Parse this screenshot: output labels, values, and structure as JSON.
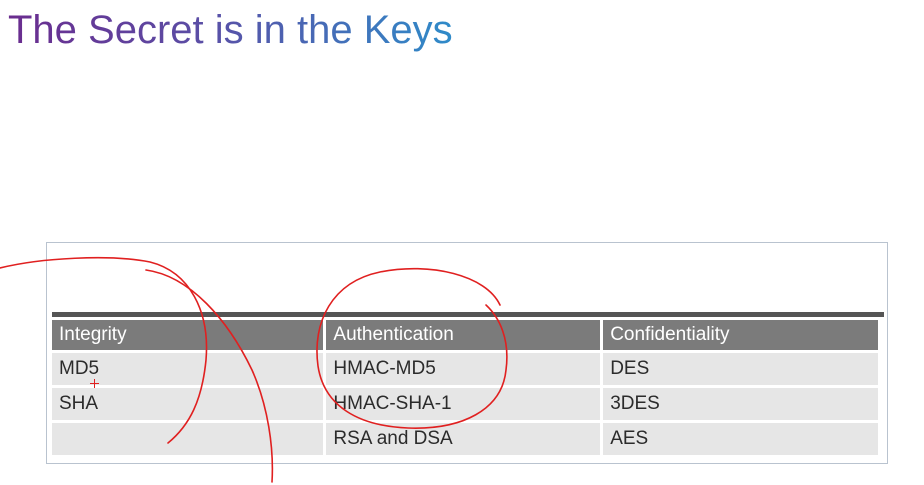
{
  "slide": {
    "title": "The Secret is in the Keys"
  },
  "table": {
    "headers": [
      "Integrity",
      "Authentication",
      "Confidentiality"
    ],
    "rows": [
      [
        "MD5",
        "HMAC-MD5",
        "DES"
      ],
      [
        "SHA",
        "HMAC-SHA-1",
        "3DES"
      ],
      [
        "",
        "RSA and DSA",
        "AES"
      ]
    ]
  },
  "colors": {
    "title_start": "#6a2c8e",
    "title_end": "#2f8bc9",
    "header_bg": "#7b7b7b",
    "cell_bg": "#e6e6e6",
    "ink_annotation": "#e02020"
  }
}
